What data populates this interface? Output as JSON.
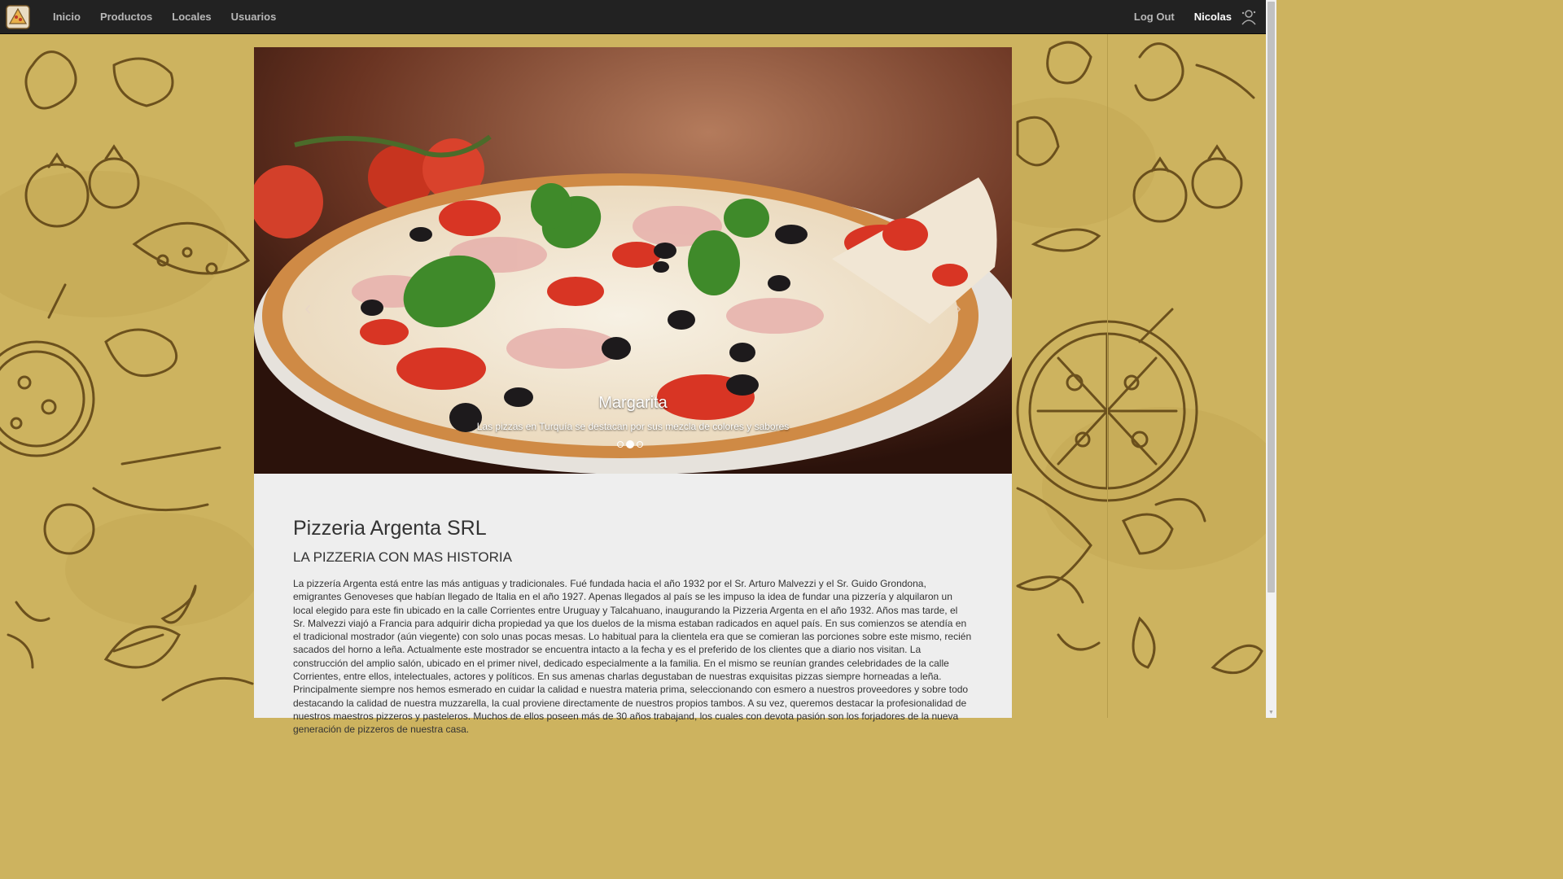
{
  "navbar": {
    "brand_icon": "pizza-logo-icon",
    "items": [
      {
        "label": "Inicio"
      },
      {
        "label": "Productos"
      },
      {
        "label": "Locales"
      },
      {
        "label": "Usuarios"
      }
    ],
    "logout_label": "Log Out",
    "user_name": "Nicolas",
    "user_icon": "user-avatar-icon"
  },
  "carousel": {
    "slide_title": "Margarita",
    "slide_text": "Las pizzas en Turquía se destacan por sus mezcla de colores y sabores",
    "prev_icon": "chevron-left-icon",
    "next_icon": "chevron-right-icon",
    "prev_glyph": "‹",
    "next_glyph": "›",
    "slide_count": 3,
    "active_slide": 2
  },
  "content": {
    "title": "Pizzeria Argenta SRL",
    "subtitle": "LA PIZZERIA CON MAS HISTORIA",
    "body": "La pizzería Argenta está entre las más antiguas y tradicionales. Fué fundada hacia el año 1932 por el Sr. Arturo Malvezzi y el Sr. Guido Grondona, emigrantes Genoveses que habían llegado de Italia en el año 1927. Apenas llegados al país se les impuso la idea de fundar una pizzería y alquilaron un local elegido para este fin ubicado en la calle Corrientes entre Uruguay y Talcahuano, inaugurando la Pizzeria Argenta en el año 1932. Años mas tarde, el Sr. Malvezzi viajó a Francia para adquirir dicha propiedad ya que los duelos de la misma estaban radicados en aquel país. En sus comienzos se atendía en el tradicional mostrador (aún viegente) con solo unas pocas mesas. Lo habitual para la clientela era que se comieran las porciones sobre este mismo, recién sacados del horno a leña. Actualmente este mostrador se encuentra intacto a la fecha y es el preferido de los clientes que a diario nos visitan. La construcción del amplio salón, ubicado en el primer nivel, dedicado especialmente a la familia. En el mismo se reunían grandes celebridades de la calle Corrientes, entre ellos, intelectuales, actores y políticos. En sus amenas charlas degustaban de nuestras exquisitas pizzas siempre horneadas a leña. Principalmente siempre nos hemos esmerado en cuidar la calidad e nuestra materia prima, seleccionando con esmero a nuestros proveedores y sobre todo destacando la calidad de nuestra muzzarella, la cual proviene directamente de nuestros propios tambos. A su vez, queremos destacar la profesionalidad de nuestros maestros pizzeros y pasteleros. Muchos de ellos poseen más de 30 años trabajand, los cuales con devota pasión son los forjadores de la nueva generación de pizzeros de nuestra casa."
  },
  "colors": {
    "navbar_bg": "#222222",
    "page_bg": "#cdb35f",
    "doodle_stroke": "#5a3f12",
    "content_bg": "#eeeeee"
  }
}
